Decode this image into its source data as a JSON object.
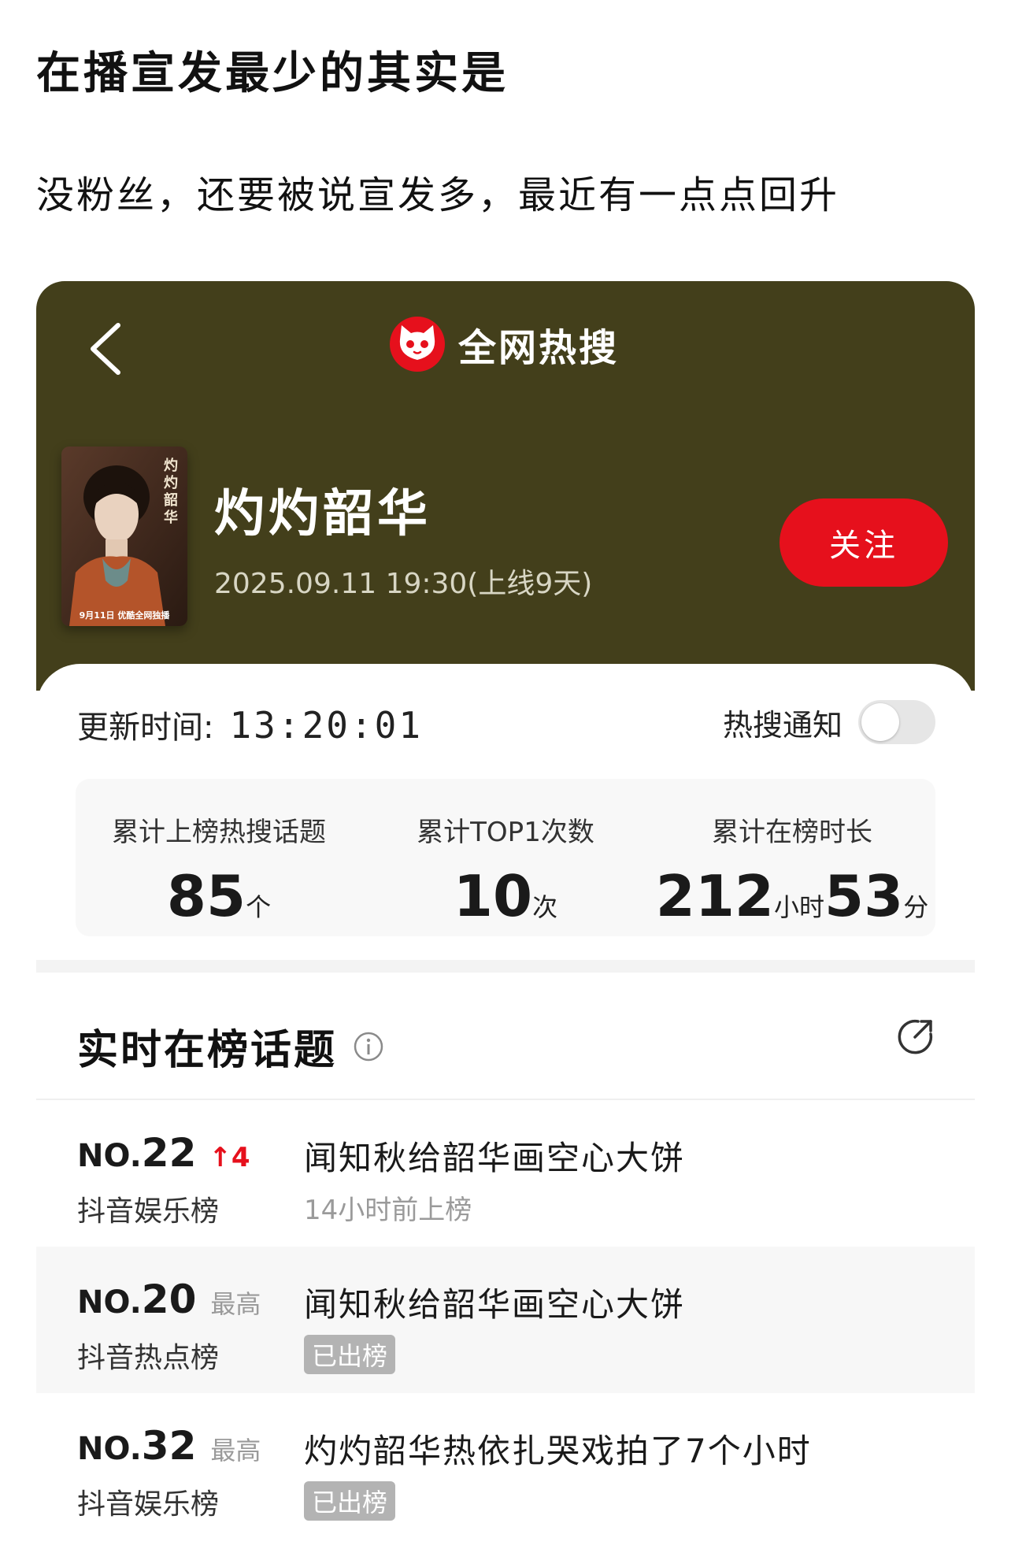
{
  "post": {
    "title": "在播宣发最少的其实是",
    "subtitle": "没粉丝，还要被说宣发多，最近有一点点回升"
  },
  "header": {
    "brand": "全网热搜"
  },
  "show": {
    "title": "灼灼韶华",
    "date": "2025.09.11 19:30(上线9天)",
    "follow_label": "关注",
    "poster_caption": "9月11日 优酷全网独播"
  },
  "update": {
    "label": "更新时间:",
    "time": "13:20:01",
    "notify_label": "热搜通知",
    "notify_on": false
  },
  "stats": [
    {
      "label": "累计上榜热搜话题",
      "value": "85",
      "unit": "个"
    },
    {
      "label": "累计TOP1次数",
      "value": "10",
      "unit": "次"
    },
    {
      "label": "累计在榜时长",
      "value": "212",
      "unit": "小时",
      "value2": "53",
      "unit2": "分"
    }
  ],
  "section": {
    "title": "实时在榜话题"
  },
  "topics": [
    {
      "prefix": "NO.",
      "rank": "22",
      "change": "↑4",
      "tag": "",
      "board": "抖音娱乐榜",
      "topic": "闻知秋给韶华画空心大饼",
      "meta": "14小时前上榜",
      "badge": ""
    },
    {
      "prefix": "NO.",
      "rank": "20",
      "change": "",
      "tag": "最高",
      "board": "抖音热点榜",
      "topic": "闻知秋给韶华画空心大饼",
      "meta": "",
      "badge": "已出榜"
    },
    {
      "prefix": "NO.",
      "rank": "32",
      "change": "",
      "tag": "最高",
      "board": "抖音娱乐榜",
      "topic": "灼灼韶华热依扎哭戏拍了7个小时",
      "meta": "",
      "badge": "已出榜"
    }
  ]
}
